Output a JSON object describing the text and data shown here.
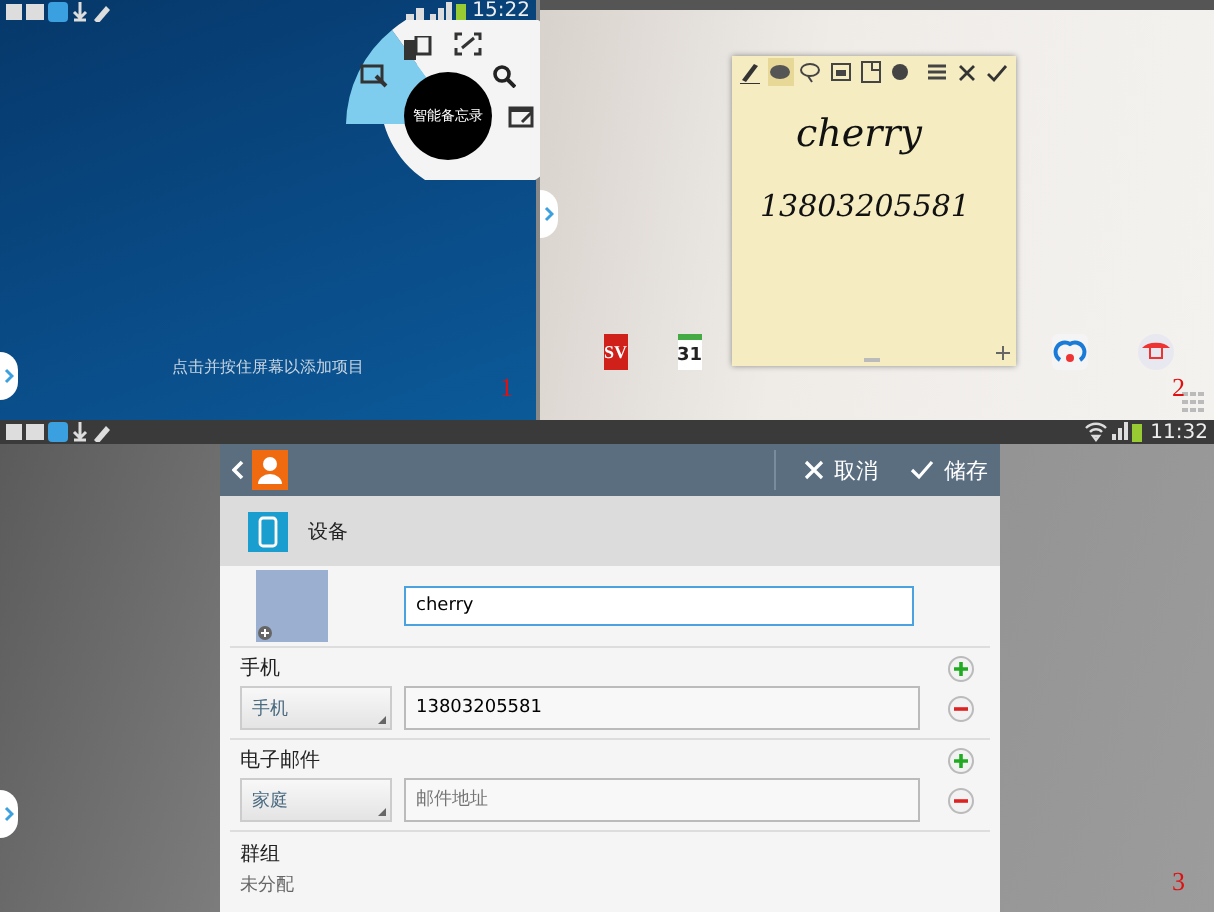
{
  "panel_1": {
    "status_bar": {
      "time": "15:22"
    },
    "pen_menu": {
      "title": "智能备忘录"
    },
    "hint": "点击并按住屏幕以添加项目",
    "number": "1"
  },
  "panel_2": {
    "memo": {
      "lines": [
        "cherry",
        "13803205581"
      ]
    },
    "apps": [
      {
        "kind": "sv",
        "label": "SV"
      },
      {
        "kind": "calendar",
        "label": "31"
      },
      {
        "kind": "cloud"
      },
      {
        "kind": "store"
      }
    ],
    "number": "2"
  },
  "panel_3": {
    "status_bar": {
      "time": "11:32"
    },
    "header": {
      "buttons": [
        {
          "kind": "cancel",
          "label": "取消"
        },
        {
          "kind": "save",
          "label": "储存"
        }
      ]
    },
    "account": "设备",
    "name_field": {
      "value": "cherry"
    },
    "sections": [
      {
        "title": "手机",
        "type_label": "手机",
        "value": "13803205581"
      },
      {
        "title": "电子邮件",
        "type_label": "家庭",
        "placeholder": "邮件地址"
      }
    ],
    "group": {
      "title": "群组",
      "value": "未分配"
    },
    "number": "3"
  }
}
